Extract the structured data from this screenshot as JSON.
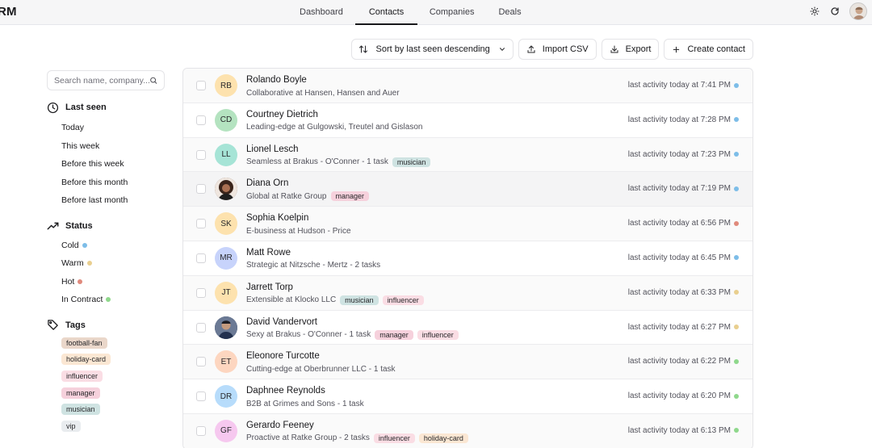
{
  "app": {
    "brand": "RM"
  },
  "nav": {
    "tabs": [
      "Dashboard",
      "Contacts",
      "Companies",
      "Deals"
    ],
    "active": "Contacts"
  },
  "header_icons": [
    "theme-toggle-icon",
    "refresh-icon",
    "user-avatar"
  ],
  "toolbar": {
    "sort_label": "Sort by last seen descending",
    "import_label": "Import CSV",
    "export_label": "Export",
    "create_label": "Create contact"
  },
  "sidebar": {
    "search_placeholder": "Search name, company...",
    "last_seen": {
      "title": "Last seen",
      "items": [
        "Today",
        "This week",
        "Before this week",
        "Before this month",
        "Before last month"
      ]
    },
    "status": {
      "title": "Status",
      "items": [
        {
          "label": "Cold",
          "color": "#7dbde8"
        },
        {
          "label": "Warm",
          "color": "#e9cf8f"
        },
        {
          "label": "Hot",
          "color": "#e08a7c"
        },
        {
          "label": "In Contract",
          "color": "#8fd88c"
        }
      ]
    },
    "tags": {
      "title": "Tags",
      "items": [
        {
          "label": "football-fan",
          "color": "#ead7ca"
        },
        {
          "label": "holiday-card",
          "color": "#fbe7d3"
        },
        {
          "label": "influencer",
          "color": "#fadde4"
        },
        {
          "label": "manager",
          "color": "#f6d1dc"
        },
        {
          "label": "musician",
          "color": "#cfe3e2"
        },
        {
          "label": "vip",
          "color": "#e9ecef"
        }
      ]
    }
  },
  "tag_colors": {
    "musician": "#cfe3e2",
    "manager": "#f6d1dc",
    "influencer": "#fadde4",
    "holiday-card": "#fbe7d3"
  },
  "contacts": [
    {
      "initials": "RB",
      "avatar_color": "#fde2ae",
      "name": "Rolando Boyle",
      "subtitle": "Collaborative at Hansen, Hansen and Auer",
      "tags": [],
      "activity": "last activity today at 7:41 PM",
      "status_color": "#7dbde8"
    },
    {
      "initials": "CD",
      "avatar_color": "#b4e3c0",
      "name": "Courtney Dietrich",
      "subtitle": "Leading-edge at Gulgowski, Treutel and Gislason",
      "tags": [],
      "activity": "last activity today at 7:28 PM",
      "status_color": "#7dbde8"
    },
    {
      "initials": "LL",
      "avatar_color": "#a6e4d6",
      "name": "Lionel Lesch",
      "subtitle": "Seamless at Brakus - O'Conner - 1 task",
      "tags": [
        "musician"
      ],
      "activity": "last activity today at 7:23 PM",
      "status_color": "#7dbde8"
    },
    {
      "initials": "",
      "avatar_photo": "photo-woman",
      "avatar_color": "#5a3b2e",
      "name": "Diana Orn",
      "subtitle": "Global at Ratke Group",
      "tags": [
        "manager"
      ],
      "activity": "last activity today at 7:19 PM",
      "status_color": "#7dbde8"
    },
    {
      "initials": "SK",
      "avatar_color": "#fde2ae",
      "name": "Sophia Koelpin",
      "subtitle": "E-business at Hudson - Price",
      "tags": [],
      "activity": "last activity today at 6:56 PM",
      "status_color": "#e08a7c"
    },
    {
      "initials": "MR",
      "avatar_color": "#c7d3fb",
      "name": "Matt Rowe",
      "subtitle": "Strategic at Nitzsche - Mertz - 2 tasks",
      "tags": [],
      "activity": "last activity today at 6:45 PM",
      "status_color": "#7dbde8"
    },
    {
      "initials": "JT",
      "avatar_color": "#fde2ae",
      "name": "Jarrett Torp",
      "subtitle": "Extensible at Klocko LLC",
      "tags": [
        "musician",
        "influencer"
      ],
      "activity": "last activity today at 6:33 PM",
      "status_color": "#e9cf8f"
    },
    {
      "initials": "",
      "avatar_photo": "photo-man",
      "avatar_color": "#2d3a55",
      "name": "David Vandervort",
      "subtitle": "Sexy at Brakus - O'Conner - 1 task",
      "tags": [
        "manager",
        "influencer"
      ],
      "activity": "last activity today at 6:27 PM",
      "status_color": "#e9cf8f"
    },
    {
      "initials": "ET",
      "avatar_color": "#fdd6c0",
      "name": "Eleonore Turcotte",
      "subtitle": "Cutting-edge at Oberbrunner LLC - 1 task",
      "tags": [],
      "activity": "last activity today at 6:22 PM",
      "status_color": "#8fd88c"
    },
    {
      "initials": "DR",
      "avatar_color": "#b7dcfb",
      "name": "Daphnee Reynolds",
      "subtitle": "B2B at Grimes and Sons - 1 task",
      "tags": [],
      "activity": "last activity today at 6:20 PM",
      "status_color": "#8fd88c"
    },
    {
      "initials": "GF",
      "avatar_color": "#f6c8ef",
      "name": "Gerardo Feeney",
      "subtitle": "Proactive at Ratke Group - 2 tasks",
      "tags": [
        "influencer",
        "holiday-card"
      ],
      "activity": "last activity today at 6:13 PM",
      "status_color": "#8fd88c"
    }
  ]
}
